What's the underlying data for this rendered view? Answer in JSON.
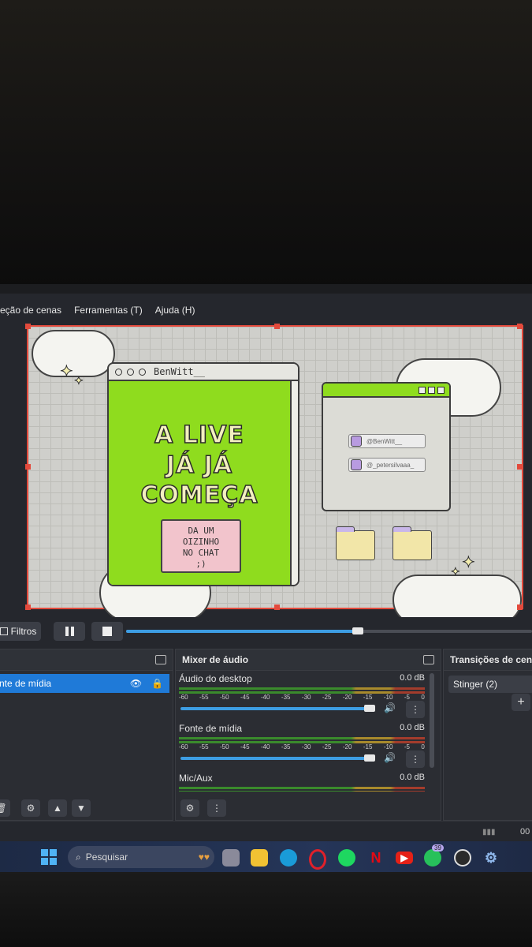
{
  "menu": {
    "items": [
      "eção de cenas",
      "Ferramentas (T)",
      "Ajuda (H)"
    ]
  },
  "preview": {
    "browser_title": "BenWitt__",
    "headline": [
      "A LIVE",
      "JÁ JÁ",
      "COMEÇA"
    ],
    "note": [
      "DA UM",
      "OIZINHO",
      "NO CHAT",
      ";)"
    ],
    "twitter": "@BenWitt__",
    "instagram": "@_petersilvaaa_",
    "accent": "#8fdc1e"
  },
  "controls": {
    "filters_label": "Filtros",
    "seek_progress": 0.57
  },
  "sources": {
    "selected_label": "nte de mídia"
  },
  "mixer": {
    "title": "Mixer de áudio",
    "scale": [
      "-60",
      "-55",
      "-50",
      "-45",
      "-40",
      "-35",
      "-30",
      "-25",
      "-20",
      "-15",
      "-10",
      "-5",
      "0"
    ],
    "channels": [
      {
        "name": "Áudio do desktop",
        "db": "0.0 dB",
        "volume": 0.97
      },
      {
        "name": "Fonte de mídia",
        "db": "0.0 dB",
        "volume": 0.97
      },
      {
        "name": "Mic/Aux",
        "db": "0.0 dB",
        "volume": 0.97
      }
    ]
  },
  "transitions": {
    "title": "Transições de cen",
    "selected": "Stinger (2)"
  },
  "status": {
    "right_text": "00"
  },
  "taskbar": {
    "search_placeholder": "Pesquisar",
    "whatsapp_badge": "39",
    "apps": [
      "widgets-icon",
      "file-explorer-icon",
      "edge-icon",
      "opera-icon",
      "spotify-icon",
      "netflix-icon",
      "youtube-icon",
      "whatsapp-icon",
      "obs-icon",
      "settings-icon"
    ]
  }
}
